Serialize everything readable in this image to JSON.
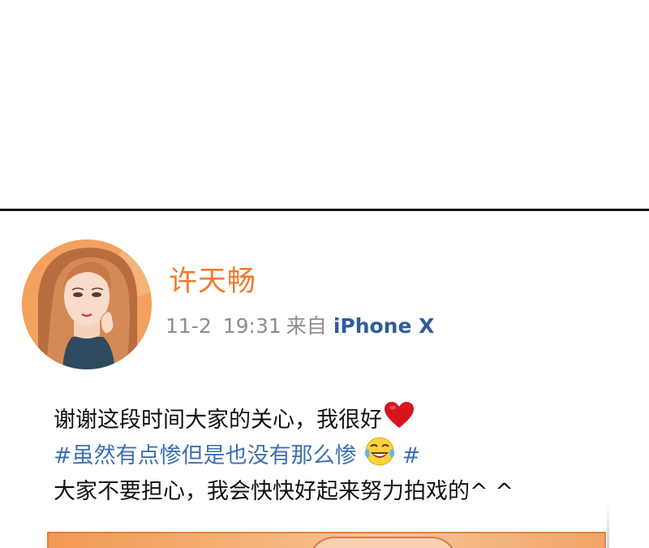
{
  "post": {
    "username": "许天畅",
    "date": "11-2",
    "time": "19:31",
    "source_prefix": "来自",
    "device": "iPhone  X",
    "line1": "谢谢这段时间大家的关心，我很好",
    "hashtag_start": "#虽然有点惨但是也没有那么惨",
    "hashtag_end": "#",
    "line3": "大家不要担心，我会快快好起来努力拍戏的^  ^"
  },
  "colors": {
    "username": "#f07b2a",
    "meta": "#8d8d8d",
    "device": "#2f5c9c",
    "hashtag": "#3f6fb3",
    "heart": "#d7141e",
    "divider": "#111111",
    "avatar_bg": "#f2a15e"
  },
  "icons": {
    "heart": "heart-emoji-icon",
    "laugh": "tears-of-joy-emoji-icon"
  }
}
